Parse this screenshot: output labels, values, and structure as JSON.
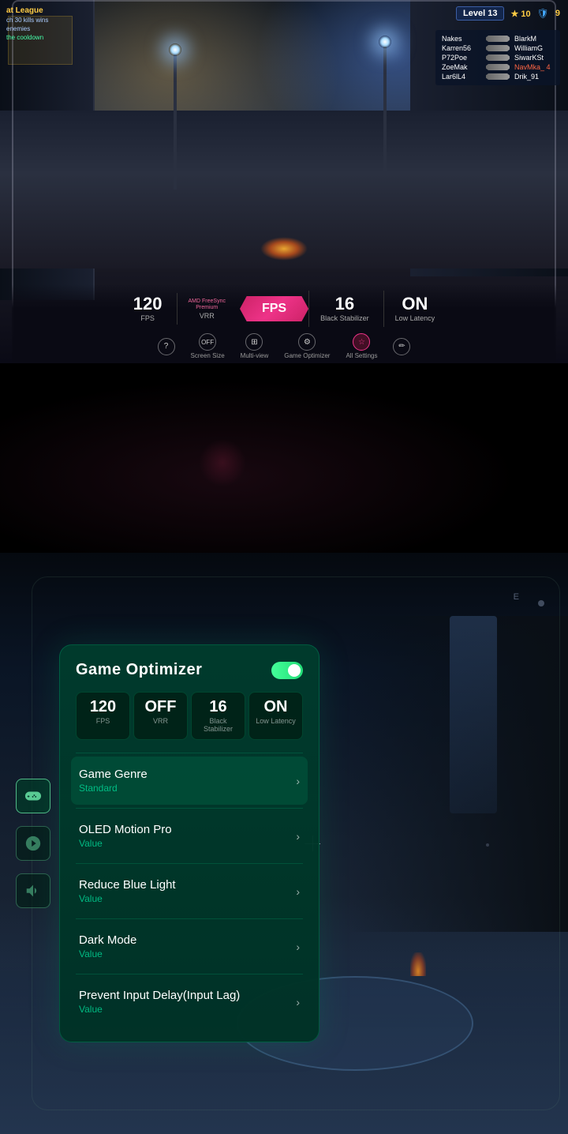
{
  "top_game": {
    "level": "Level 13",
    "score": "10",
    "kills_label": "at League",
    "kills_desc": "ch 30 kills wins",
    "kills_sub": "enemies",
    "kills_cd": "the cooldown",
    "scoreboard": [
      {
        "name": "Nakes",
        "enemy": "BlarkM",
        "kills": ""
      },
      {
        "name": "Karren56",
        "enemy": "WilliamG",
        "kills": ""
      },
      {
        "name": "P72Poe",
        "enemy": "SiwarKSt",
        "kills": ""
      },
      {
        "name": "ZoeMak",
        "enemy": "NavMka_8",
        "kills": "4"
      },
      {
        "name": "Lar6lL4",
        "enemy": "Drik_91",
        "kills": ""
      }
    ],
    "stats": [
      {
        "value": "120",
        "label": "FPS"
      },
      {
        "value": "AMD\nFreeSync\nPremium",
        "label": "VRR"
      },
      {
        "value": "FPS",
        "label": "",
        "active": true
      },
      {
        "value": "16",
        "label": "Black Stabilizer"
      },
      {
        "value": "ON",
        "label": "Low Latency"
      }
    ],
    "menu": [
      {
        "icon": "?",
        "label": ""
      },
      {
        "icon": "□",
        "label": "Screen Size"
      },
      {
        "icon": "⊞",
        "label": "Multi-view"
      },
      {
        "icon": "⚙",
        "label": "Game Optimizer",
        "active": false
      },
      {
        "icon": "☆",
        "label": "All Settings",
        "active": true
      },
      {
        "icon": "✏",
        "label": ""
      }
    ]
  },
  "optimizer_panel": {
    "title": "Game Optimizer",
    "toggle_on": true,
    "mini_stats": [
      {
        "value": "120",
        "label": "FPS"
      },
      {
        "value": "OFF",
        "label": "VRR"
      },
      {
        "value": "16",
        "label": "Black Stabilizer"
      },
      {
        "value": "ON",
        "label": "Low Latency"
      }
    ],
    "menu_items": [
      {
        "label": "Game Genre",
        "value": "Standard",
        "active": true,
        "has_arrow": true
      },
      {
        "label": "OLED Motion Pro",
        "value": "Value",
        "active": false,
        "has_arrow": true
      },
      {
        "label": "Reduce Blue Light",
        "value": "Value",
        "active": false,
        "has_arrow": true
      },
      {
        "label": "Dark Mode",
        "value": "Value",
        "active": false,
        "has_arrow": true
      },
      {
        "label": "Prevent Input Delay(Input Lag)",
        "value": "Value",
        "active": false,
        "has_arrow": true
      }
    ]
  },
  "sidebar_icons": [
    {
      "icon": "🎮",
      "label": "gamepad",
      "active": true
    },
    {
      "icon": "✦",
      "label": "display",
      "active": false
    },
    {
      "icon": "🔊",
      "label": "audio",
      "active": false
    }
  ]
}
